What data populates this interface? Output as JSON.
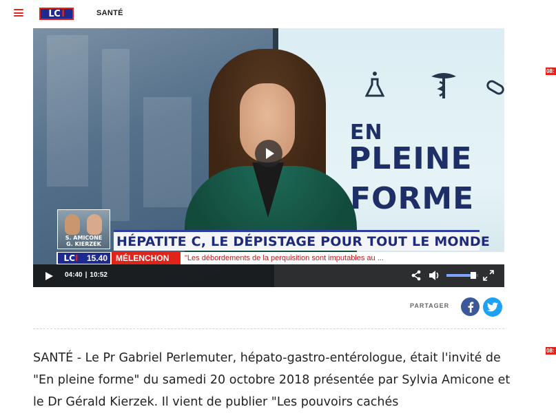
{
  "header": {
    "logo_left": "LC",
    "logo_i": "I",
    "section": "SANTÉ"
  },
  "video": {
    "show_word_1": "EN",
    "show_word_2": "PLEINE",
    "show_word_3": "FORME",
    "guests_line_1": "S. AMICONE",
    "guests_line_2": "G. KIERZEK",
    "headline": "HÉPATITE C, LE DÉPISTAGE POUR TOUT LE MONDE",
    "ticker": {
      "logo_left": "LC",
      "logo_i": "I",
      "time": "15.40",
      "tag": "MÉLENCHON",
      "text": "\"Les débordements de la perquisition sont imputables au ..."
    },
    "controls": {
      "current_time": "04:40",
      "separator": "|",
      "duration": "10:52",
      "volume_level": 0.85
    }
  },
  "share": {
    "label": "PARTAGER"
  },
  "article": {
    "text": "SANTÉ - Le Pr Gabriel Perlemuter, hépato-gastro-entérologue, était l'invité de \"En pleine forme\" du samedi 20 octobre 2018 présentée par Sylvia Amicone et le Dr Gérald Kierzek. Il vient de publier \"Les pouvoirs cachés"
  },
  "side_badges": [
    "08:",
    "08:"
  ]
}
